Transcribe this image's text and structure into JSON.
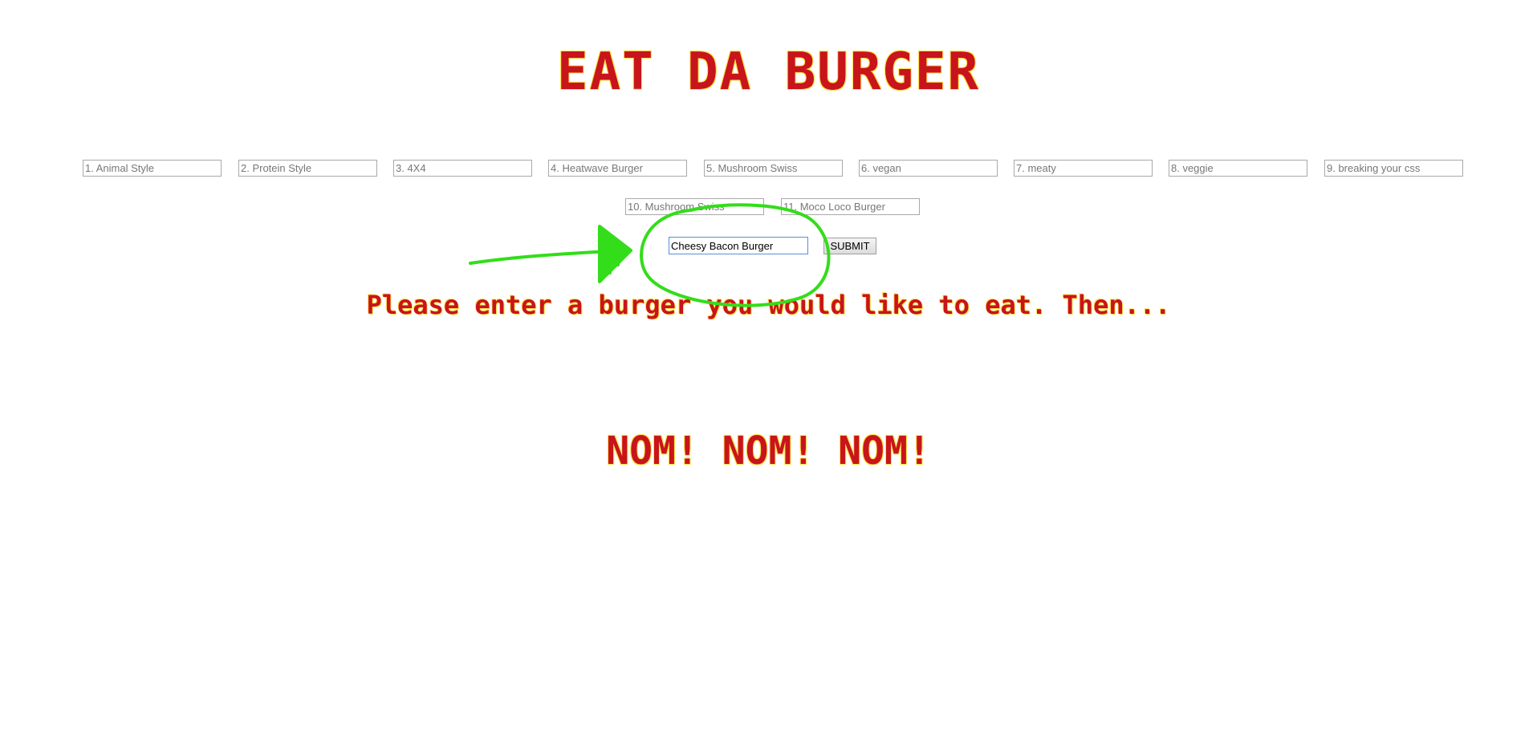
{
  "header": {
    "title": "EAT DA BURGER"
  },
  "burgers": [
    {
      "placeholder": "1. Animal Style"
    },
    {
      "placeholder": "2. Protein Style"
    },
    {
      "placeholder": "3. 4X4"
    },
    {
      "placeholder": "4. Heatwave Burger"
    },
    {
      "placeholder": "5. Mushroom Swiss"
    },
    {
      "placeholder": "6. vegan"
    },
    {
      "placeholder": "7. meaty"
    },
    {
      "placeholder": "8. veggie"
    },
    {
      "placeholder": "9. breaking your css"
    },
    {
      "placeholder": "10. Mushroom Swiss"
    },
    {
      "placeholder": "11. Moco Loco Burger"
    }
  ],
  "form": {
    "new_burger_value": "Cheesy Bacon Burger",
    "submit_label": "SUBMIT"
  },
  "instruction": "Please enter a burger you would like to eat. Then...",
  "footer_text": "NOM! NOM! NOM!",
  "colors": {
    "title_red": "#c8141b",
    "title_outline": "#ffe14a",
    "annotation_green": "#33dd1a",
    "input_focus_border": "#5b8fd6"
  },
  "annotation": {
    "shapes": [
      "arrow-icon",
      "circle-highlight"
    ]
  }
}
